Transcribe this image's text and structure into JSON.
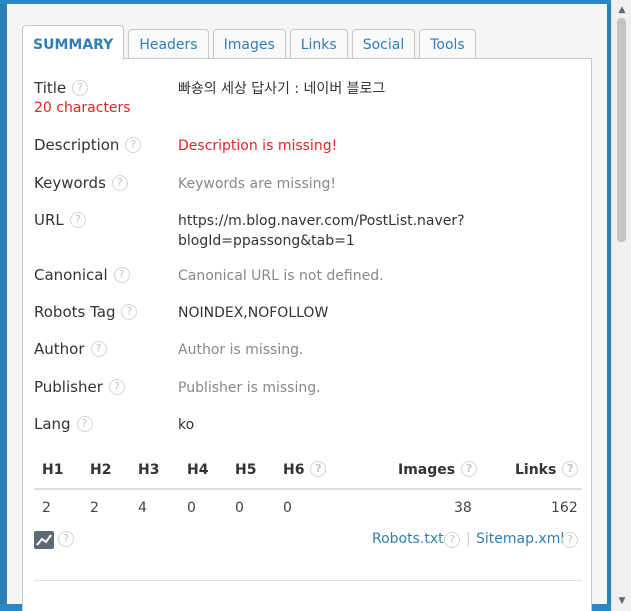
{
  "tabs": [
    {
      "label": "SUMMARY",
      "active": true
    },
    {
      "label": "Headers"
    },
    {
      "label": "Images"
    },
    {
      "label": "Links"
    },
    {
      "label": "Social"
    },
    {
      "label": "Tools"
    }
  ],
  "summary": {
    "title": {
      "label": "Title",
      "value": "빠숑의 세상 답사기 : 네이버 블로그",
      "count": "20 characters"
    },
    "description": {
      "label": "Description",
      "value": "Description is missing!"
    },
    "keywords": {
      "label": "Keywords",
      "value": "Keywords are missing!"
    },
    "url": {
      "label": "URL",
      "line1": "https://m.blog.naver.com/PostList.naver?",
      "line2": "blogId=ppassong&tab=1"
    },
    "canonical": {
      "label": "Canonical",
      "value": "Canonical URL is not defined."
    },
    "robots": {
      "label": "Robots Tag",
      "value": "NOINDEX,NOFOLLOW"
    },
    "author": {
      "label": "Author",
      "value": "Author is missing."
    },
    "publisher": {
      "label": "Publisher",
      "value": "Publisher is missing."
    },
    "lang": {
      "label": "Lang",
      "value": "ko"
    }
  },
  "headings": {
    "columns": [
      "H1",
      "H2",
      "H3",
      "H4",
      "H5",
      "H6",
      "Images",
      "Links"
    ],
    "values": [
      "2",
      "2",
      "4",
      "0",
      "0",
      "0",
      "38",
      "162"
    ]
  },
  "links": {
    "robots": "Robots.txt",
    "sitemap": "Sitemap.xml",
    "separator": "|"
  },
  "help_glyph": "?",
  "icons": {
    "chart": "chart-line-icon",
    "help": "question-circle-icon"
  },
  "colors": {
    "accent": "#2f7fb5",
    "error": "#e02424",
    "frame": "#2b87c6"
  }
}
